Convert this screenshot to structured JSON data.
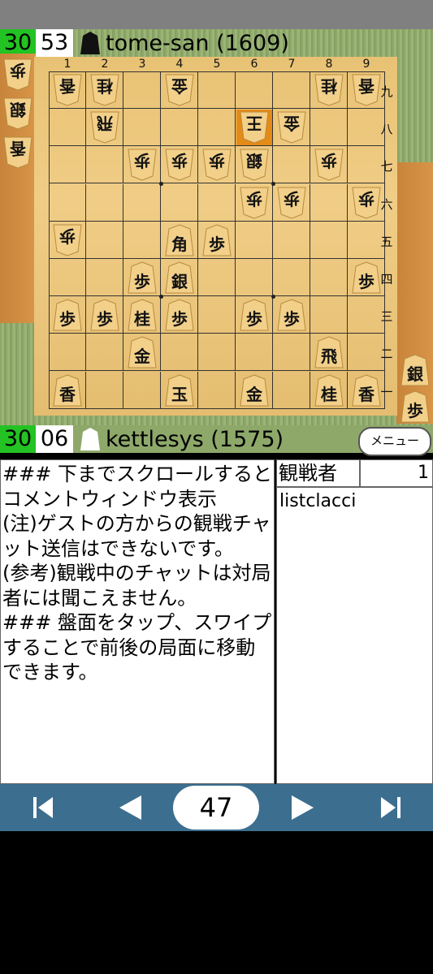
{
  "top_player": {
    "clock_min": "30",
    "clock_sec": "53",
    "name": "tome-san (1609)"
  },
  "bottom_player": {
    "clock_min": "30",
    "clock_sec": "06",
    "name": "kettlesys (1575)"
  },
  "menu_label": "メニュー",
  "board": {
    "files": [
      "1",
      "2",
      "3",
      "4",
      "5",
      "6",
      "7",
      "8",
      "9"
    ],
    "ranks": [
      "九",
      "八",
      "七",
      "六",
      "五",
      "四",
      "三",
      "二",
      "一"
    ],
    "highlight_color": "#e48a17",
    "pieces": [
      {
        "k": "香",
        "c": 1,
        "r": 1,
        "g": true
      },
      {
        "k": "桂",
        "c": 2,
        "r": 1,
        "g": true
      },
      {
        "k": "金",
        "c": 4,
        "r": 1,
        "g": true
      },
      {
        "k": "桂",
        "c": 8,
        "r": 1,
        "g": true
      },
      {
        "k": "香",
        "c": 9,
        "r": 1,
        "g": true
      },
      {
        "k": "飛",
        "c": 2,
        "r": 2,
        "g": true
      },
      {
        "k": "王",
        "c": 6,
        "r": 2,
        "g": true,
        "hl": true
      },
      {
        "k": "金",
        "c": 7,
        "r": 2,
        "g": true
      },
      {
        "k": "歩",
        "c": 3,
        "r": 3,
        "g": true
      },
      {
        "k": "歩",
        "c": 4,
        "r": 3,
        "g": true
      },
      {
        "k": "歩",
        "c": 5,
        "r": 3,
        "g": true
      },
      {
        "k": "銀",
        "c": 6,
        "r": 3,
        "g": true
      },
      {
        "k": "歩",
        "c": 8,
        "r": 3,
        "g": true
      },
      {
        "k": "歩",
        "c": 6,
        "r": 4,
        "g": true
      },
      {
        "k": "歩",
        "c": 7,
        "r": 4,
        "g": true
      },
      {
        "k": "歩",
        "c": 9,
        "r": 4,
        "g": true
      },
      {
        "k": "歩",
        "c": 1,
        "r": 5,
        "g": true
      },
      {
        "k": "角",
        "c": 4,
        "r": 5,
        "g": false
      },
      {
        "k": "歩",
        "c": 5,
        "r": 5,
        "g": false
      },
      {
        "k": "歩",
        "c": 3,
        "r": 6,
        "g": false
      },
      {
        "k": "銀",
        "c": 4,
        "r": 6,
        "g": false
      },
      {
        "k": "歩",
        "c": 9,
        "r": 6,
        "g": false
      },
      {
        "k": "歩",
        "c": 1,
        "r": 7,
        "g": false
      },
      {
        "k": "歩",
        "c": 2,
        "r": 7,
        "g": false
      },
      {
        "k": "桂",
        "c": 3,
        "r": 7,
        "g": false
      },
      {
        "k": "歩",
        "c": 4,
        "r": 7,
        "g": false
      },
      {
        "k": "歩",
        "c": 6,
        "r": 7,
        "g": false
      },
      {
        "k": "歩",
        "c": 7,
        "r": 7,
        "g": false
      },
      {
        "k": "金",
        "c": 3,
        "r": 8,
        "g": false
      },
      {
        "k": "飛",
        "c": 8,
        "r": 8,
        "g": false
      },
      {
        "k": "香",
        "c": 1,
        "r": 9,
        "g": false
      },
      {
        "k": "玉",
        "c": 4,
        "r": 9,
        "g": false
      },
      {
        "k": "金",
        "c": 6,
        "r": 9,
        "g": false
      },
      {
        "k": "桂",
        "c": 8,
        "r": 9,
        "g": false
      },
      {
        "k": "香",
        "c": 9,
        "r": 9,
        "g": false
      }
    ]
  },
  "gote_hand": [
    "歩",
    "銀",
    "香"
  ],
  "sente_hand": [
    "銀",
    "歩"
  ],
  "comment_text": "### 下までスクロールするとコメントウィンドウ表示\n(注)ゲストの方からの観戦チャット送信はできないです。\n(参考)観戦中のチャットは対局者には聞こえません。\n### 盤面をタップ、スワイプすることで前後の局面に移動できます。",
  "watchers": {
    "label": "観戦者",
    "count": "1",
    "list": [
      "listclacci"
    ]
  },
  "nav": {
    "move_number": "47",
    "first_icon": "skip-first-icon",
    "prev_icon": "prev-icon",
    "next_icon": "next-icon",
    "last_icon": "skip-last-icon"
  }
}
